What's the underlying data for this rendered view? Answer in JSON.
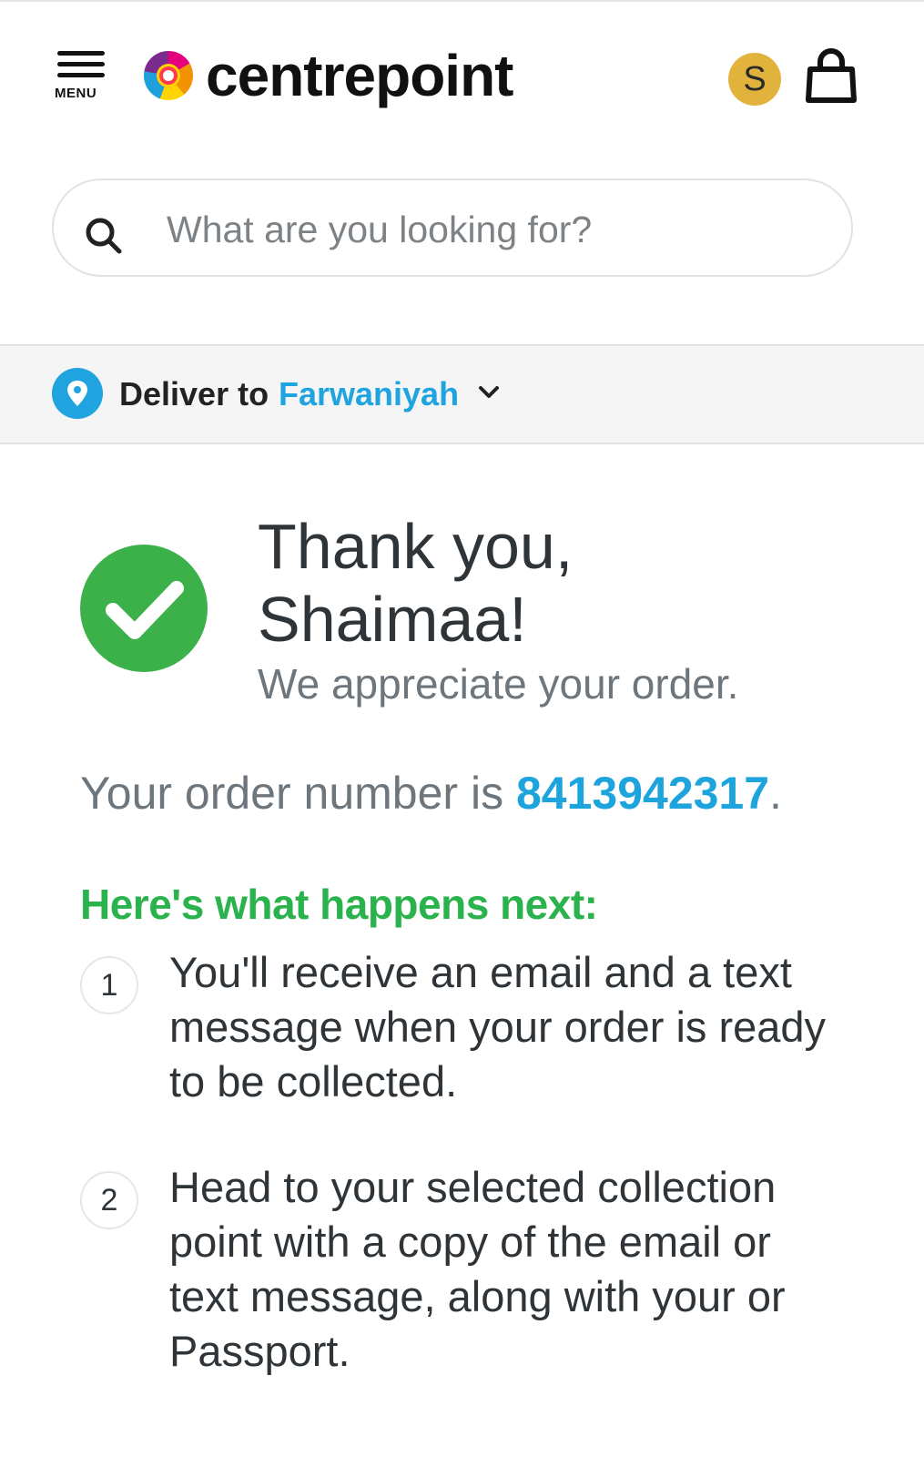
{
  "header": {
    "menu_label": "MENU",
    "logo_text": "centrepoint",
    "coin_symbol": "S"
  },
  "search": {
    "placeholder": "What are you looking for?"
  },
  "delivery": {
    "label": "Deliver to",
    "location": "Farwaniyah"
  },
  "confirmation": {
    "thanks_line1": "Thank you,",
    "thanks_line2": "Shaimaa!",
    "appreciate": "We appreciate your order.",
    "order_prefix": "Your order number is ",
    "order_number": "8413942317",
    "order_suffix": "."
  },
  "next_steps": {
    "heading": "Here's what happens next:",
    "items": [
      {
        "number": "1",
        "text": "You'll receive an email and a text message when your order is ready to be collected."
      },
      {
        "number": "2",
        "text": "Head to your selected collection point with a copy of the email or text message, along with your or Passport."
      }
    ]
  },
  "colors": {
    "accent_blue": "#1fa4e0",
    "success_green": "#3cb14a",
    "coin_gold": "#e2b33c"
  }
}
